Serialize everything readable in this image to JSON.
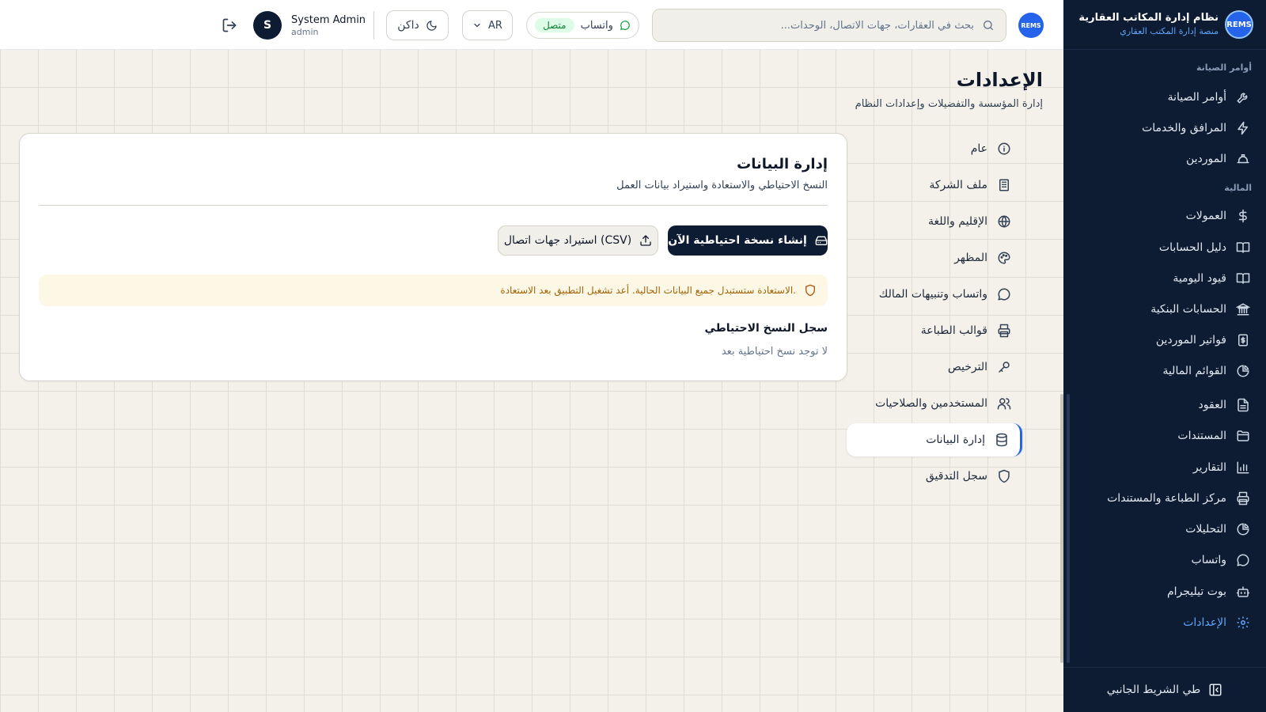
{
  "app": {
    "name": "نظام إدارة المكاتب العقارية",
    "subtitle": "منصة إدارة المكتب العقاري",
    "logo_text": "REMS"
  },
  "sidebar": {
    "sections": [
      {
        "label": "أوامر الصيانة"
      },
      {
        "label": "المالية"
      }
    ],
    "items": [
      {
        "label": "أوامر الصيانة",
        "icon": "wrench-icon"
      },
      {
        "label": "المرافق والخدمات",
        "icon": "bolt-icon"
      },
      {
        "label": "الموردين",
        "icon": "hard-hat-icon"
      },
      {
        "label": "العمولات",
        "icon": "dollar-icon"
      },
      {
        "label": "دليل الحسابات",
        "icon": "book-icon"
      },
      {
        "label": "قيود اليومية",
        "icon": "book-open-icon"
      },
      {
        "label": "الحسابات البنكية",
        "icon": "bank-icon"
      },
      {
        "label": "فواتير الموردين",
        "icon": "invoice-icon"
      },
      {
        "label": "القوائم المالية",
        "icon": "pie-chart-icon"
      },
      {
        "label": "العقود",
        "icon": "file-text-icon"
      },
      {
        "label": "المستندات",
        "icon": "folder-icon"
      },
      {
        "label": "التقارير",
        "icon": "bar-chart-icon"
      },
      {
        "label": "مركز الطباعة والمستندات",
        "icon": "printer-icon"
      },
      {
        "label": "التحليلات",
        "icon": "pie-chart-icon"
      },
      {
        "label": "واتساب",
        "icon": "chat-icon"
      },
      {
        "label": "بوت تيليجرام",
        "icon": "bot-icon"
      },
      {
        "label": "الإعدادات",
        "icon": "gear-icon",
        "active": true
      }
    ],
    "collapse_label": "طي الشريط الجانبي"
  },
  "header": {
    "search_placeholder": "بحث في العقارات، جهات الاتصال، الوحدات...",
    "whatsapp_label": "واتساب",
    "whatsapp_status": "متصل",
    "language": "AR",
    "theme_label": "داكن",
    "user": {
      "initial": "S",
      "name": "System Admin",
      "role": "admin"
    }
  },
  "page": {
    "title": "الإعدادات",
    "subtitle": "إدارة المؤسسة والتفضيلات وإعدادات النظام"
  },
  "settings_nav": [
    {
      "label": "عام",
      "icon": "info-icon"
    },
    {
      "label": "ملف الشركة",
      "icon": "building-icon"
    },
    {
      "label": "الإقليم واللغة",
      "icon": "globe-icon"
    },
    {
      "label": "المظهر",
      "icon": "palette-icon"
    },
    {
      "label": "واتساب وتنبيهات المالك",
      "icon": "chat-icon"
    },
    {
      "label": "قوالب الطباعة",
      "icon": "printer-icon"
    },
    {
      "label": "الترخيص",
      "icon": "key-icon"
    },
    {
      "label": "المستخدمين والصلاحيات",
      "icon": "users-icon"
    },
    {
      "label": "إدارة البيانات",
      "icon": "database-icon",
      "active": true
    },
    {
      "label": "سجل التدقيق",
      "icon": "shield-icon"
    }
  ],
  "card": {
    "title": "إدارة البيانات",
    "subtitle": "النسخ الاحتياطي والاستعادة واستيراد بيانات العمل",
    "backup_button": "إنشاء نسخة احتياطية الآن",
    "import_button": "استيراد جهات اتصال (CSV)",
    "warning": "الاستعادة ستستبدل جميع البيانات الحالية. أعد تشغيل التطبيق بعد الاستعادة.",
    "log_title": "سجل النسخ الاحتياطي",
    "log_empty": "لا توجد نسخ احتياطية بعد"
  },
  "colors": {
    "sidebar_bg": "#0d1b33",
    "accent": "#2563eb",
    "primary_button": "#0d1b33",
    "warning_bg": "#fdf8e6",
    "warning_text": "#a16207",
    "status_green": "#15803d",
    "page_bg": "#f4f1ea"
  }
}
